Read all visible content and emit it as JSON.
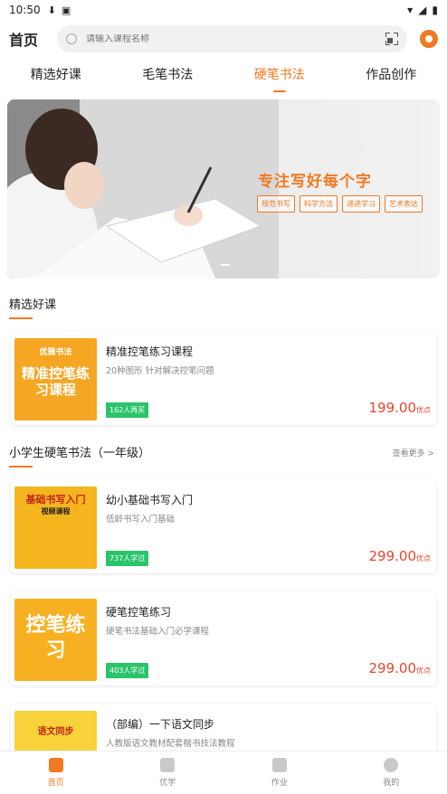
{
  "status_bar": {
    "time": "10:50"
  },
  "header": {
    "title": "首页",
    "search_placeholder": "请输入课程名称"
  },
  "tabs": [
    {
      "label": "精选好课",
      "active": false
    },
    {
      "label": "毛笔书法",
      "active": false
    },
    {
      "label": "硬笔书法",
      "active": true
    },
    {
      "label": "作品创作",
      "active": false
    }
  ],
  "banner": {
    "slogan": "专注写好每个字",
    "tags": [
      "规范书写",
      "科学方法",
      "递进学习",
      "艺术表达"
    ]
  },
  "featured": {
    "section_title": "精选好课",
    "card": {
      "thumb_brand": "优雅书法",
      "thumb_title": "精准控笔练习课程",
      "title": "精准控笔练习课程",
      "desc": "20种图形 针对解决控笔问题",
      "badge": "162人再买",
      "price": "199.00",
      "unit": "优点"
    }
  },
  "grade_section": {
    "section_title": "小学生硬笔书法（一年级）",
    "view_more": "查看更多 >",
    "cards": [
      {
        "thumb_title": "基础书写入门",
        "thumb_sub": "视频课程",
        "title": "幼小基础书写入门",
        "desc": "低龄书写入门基础",
        "badge": "737人学过",
        "price": "299.00",
        "unit": "优点"
      },
      {
        "thumb_title": "控笔练习",
        "title": "硬笔控笔练习",
        "desc": "硬笔书法基础入门必学课程",
        "badge": "403人学过",
        "price": "299.00",
        "unit": "优点"
      },
      {
        "thumb_title": "语文同步",
        "title": "（部编）一下语文同步",
        "desc": "人教版语文教材配套楷书技法教程"
      }
    ]
  },
  "bottom_nav": [
    {
      "label": "首页",
      "active": true,
      "icon": "home-icon"
    },
    {
      "label": "优学",
      "active": false,
      "icon": "book-icon"
    },
    {
      "label": "作业",
      "active": false,
      "icon": "homework-icon"
    },
    {
      "label": "我的",
      "active": false,
      "icon": "profile-icon"
    }
  ],
  "colors": {
    "accent": "#f07a22",
    "price": "#e8452c",
    "badge": "#2bc46a"
  }
}
